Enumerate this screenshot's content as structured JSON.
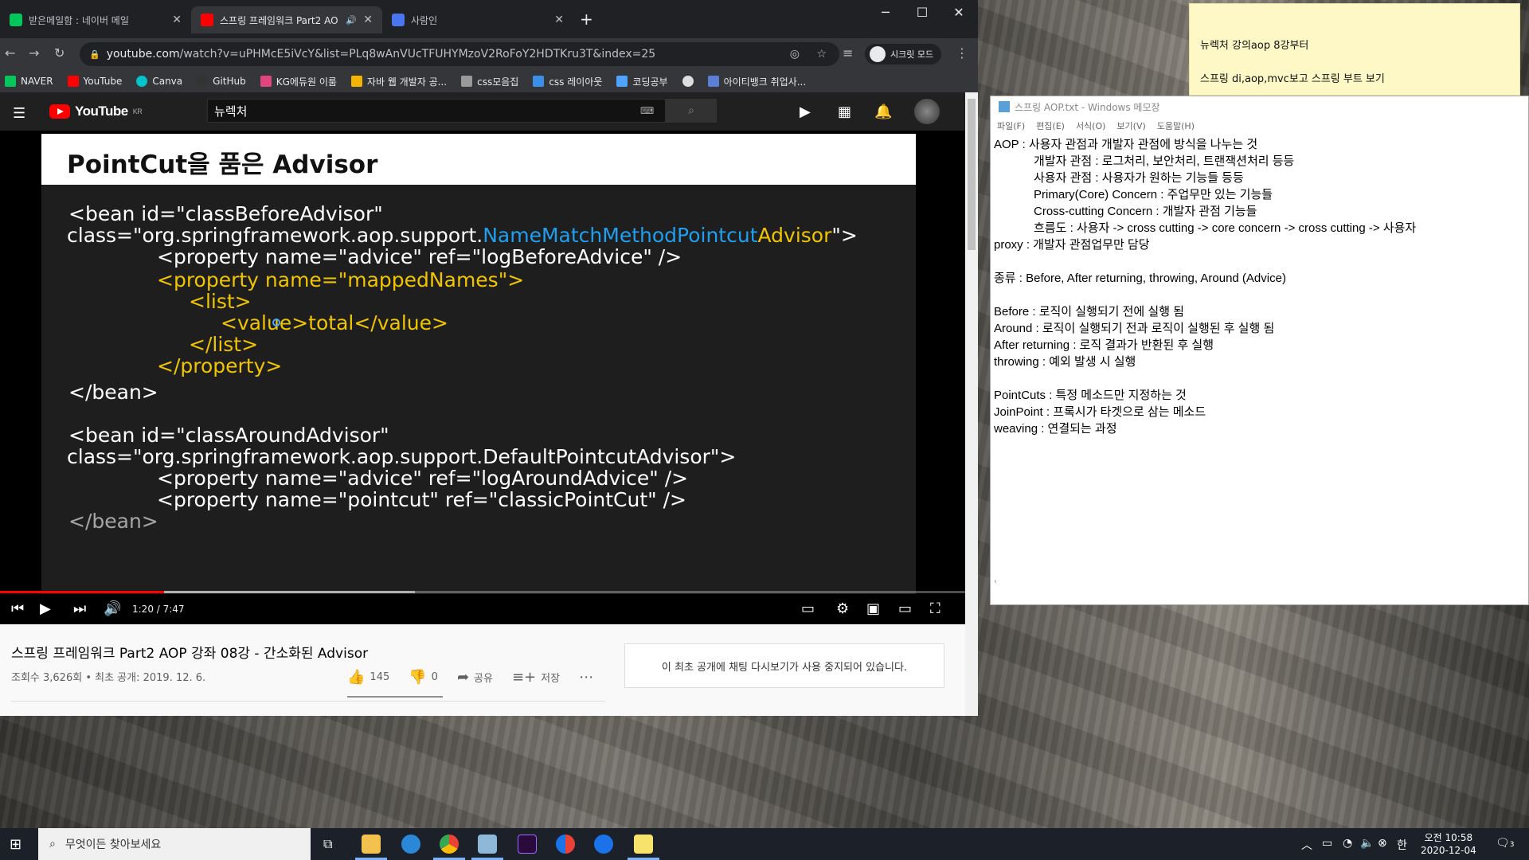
{
  "browser": {
    "tabs": [
      {
        "title": "받은메일함 : 네이버 메일",
        "color": "#03c75a"
      },
      {
        "title": "스프링 프레임워크 Part2 AO",
        "color": "#ff0000"
      },
      {
        "title": "사람인",
        "color": "#4876ef"
      }
    ],
    "url_host": "youtube.com",
    "url_path": "/watch?v=uPHMcE5iVcY&list=PLq8wAnVUcTFUHYMzoV2RoFoY2HDTKru3T&index=25",
    "incognito_label": "시크릿 모드",
    "bookmarks": [
      {
        "label": "NAVER",
        "color": "#03c75a"
      },
      {
        "label": "YouTube",
        "color": "#ff0000"
      },
      {
        "label": "Canva",
        "color": "#00c4cc"
      },
      {
        "label": "GitHub",
        "color": "#333333"
      },
      {
        "label": "KG에듀원 이룸",
        "color": "#e0457b"
      },
      {
        "label": "자바 웹 개발자 공...",
        "color": "#f4b400"
      },
      {
        "label": "css모음집",
        "color": "#999999"
      },
      {
        "label": "css 레이아웃",
        "color": "#3b8eea"
      },
      {
        "label": "코딩공부",
        "color": "#4da3ff"
      },
      {
        "label": "",
        "color": "#dddddd"
      },
      {
        "label": "아이티뱅크 취업사...",
        "color": "#5b7fd6"
      }
    ]
  },
  "youtube": {
    "logo": "YouTube",
    "region": "KR",
    "search_value": "뉴렉처",
    "player": {
      "slide_title": "PointCut을 품은 Advisor",
      "lines": {
        "l1": "<bean id=\"classBeforeAdvisor\"",
        "l2a": "class=\"org.springframework.aop.support.",
        "l2b": "NameMatchMethodPointcut",
        "l2c": "Advisor",
        "l2d": "\">",
        "l3": "<property name=\"advice\" ref=\"logBeforeAdvice\" />",
        "l4": "<property name=\"mappedNames\">",
        "l5": "<list>",
        "l6": "<value>total</value>",
        "l7": "</list>",
        "l8": "</property>",
        "l9": "</bean>",
        "l10": "<bean id=\"classAroundAdvisor\"",
        "l11": "class=\"org.springframework.aop.support.DefaultPointcutAdvisor\">",
        "l12": "<property name=\"advice\" ref=\"logAroundAdvice\" />",
        "l13": "<property name=\"pointcut\" ref=\"classicPointCut\" />",
        "l14": "</bean>"
      },
      "time": "1:20 / 7:47",
      "progress_played": 0.17,
      "progress_loaded": 0.43
    },
    "video_title": "스프링 프레임워크 Part2 AOP 강좌 08강 - 간소화된 Advisor",
    "meta": "조회수 3,626회 • 최초 공개: 2019. 12. 6.",
    "likes": "145",
    "dislikes": "0",
    "share": "공유",
    "save": "저장",
    "chat_notice": "이 최초 공개에 채팅 다시보기가 사용 중지되어 있습니다."
  },
  "sticky": {
    "line1": "뉴렉처 강의aop 8강부터",
    "line2": "스프링 di,aop,mvc보고 스프링 부트 보기"
  },
  "notepad": {
    "title": "스프링 AOP.txt - Windows 메모장",
    "menu": [
      "파일(F)",
      "편집(E)",
      "서식(O)",
      "보기(V)",
      "도움말(H)"
    ],
    "content": "AOP : 사용자 관점과 개발자 관점에 방식을 나누는 것\n            개발자 관점 : 로그처리, 보안처리, 트랜잭션처리 등등\n            사용자 관점 : 사용자가 원하는 기능들 등등\n            Primary(Core) Concern : 주업무만 있는 기능들\n            Cross-cutting Concern : 개발자 관점 기능들\n            흐름도 : 사용자 -> cross cutting -> core concern -> cross cutting -> 사용자\nproxy : 개발자 관점업무만 담당\n\n종류 : Before, After returning, throwing, Around (Advice)\n\nBefore : 로직이 실행되기 전에 실행 됨\nAround : 로직이 실행되기 전과 로직이 실행된 후 실행 됨\nAfter returning : 로직 결과가 반환된 후 실행\nthrowing : 예외 발생 시 실행\n\nPointCuts : 특정 메소드만 지정하는 것\nJoinPoint : 프록시가 타겟으로 삼는 메소드\nweaving : 연결되는 과정"
  },
  "taskbar": {
    "search_placeholder": "무엇이든 찾아보세요",
    "time": "오전 10:58",
    "date": "2020-12-04",
    "ime": "한",
    "notif_count": "3"
  }
}
